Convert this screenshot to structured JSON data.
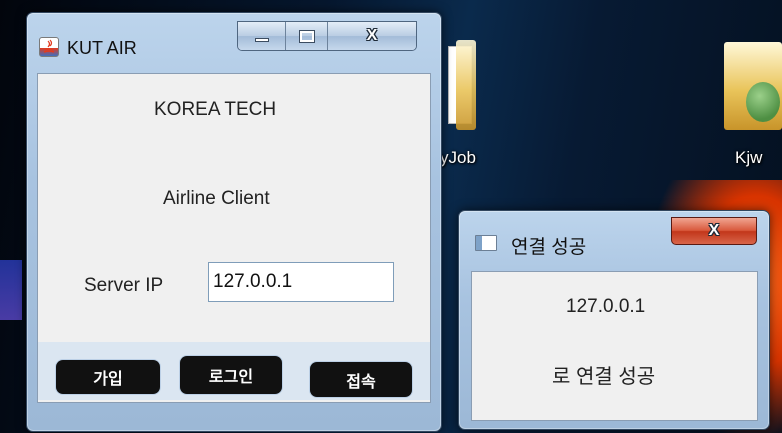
{
  "main_window": {
    "title": "KUT AIR",
    "heading": "KOREA TECH",
    "subheading": "Airline Client",
    "server_ip_label": "Server IP",
    "server_ip_value": "127.0.0.1",
    "buttons": {
      "join": "가입",
      "login": "로그인",
      "connect": "접속"
    },
    "caption": {
      "close": "X"
    }
  },
  "dialog": {
    "title": "연결 성공",
    "ip_text": "127.0.0.1",
    "message": "로 연결 성공",
    "caption": {
      "close": "X"
    }
  },
  "desktop": {
    "icons": [
      {
        "label": "yJob",
        "icon": "folder-icon"
      },
      {
        "label": "Kjw",
        "icon": "user-folder-icon"
      }
    ]
  },
  "colors": {
    "title_bar": "#b2cbe6",
    "client_bg": "#f0f0f0",
    "close_red": "#c8391c",
    "button_black": "#111111"
  }
}
